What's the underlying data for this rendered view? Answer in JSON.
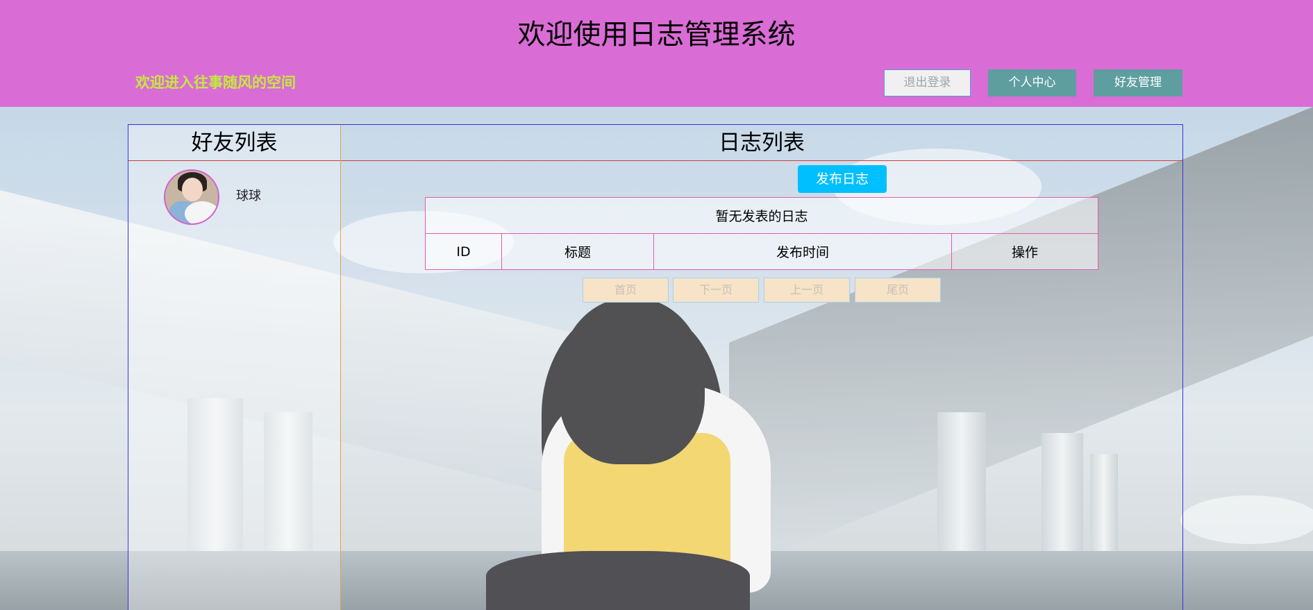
{
  "header": {
    "title": "欢迎使用日志管理系统",
    "welcome": "欢迎进入往事随风的空间",
    "logout_label": "退出登录",
    "profile_label": "个人中心",
    "friends_label": "好友管理"
  },
  "friends": {
    "title": "好友列表",
    "items": [
      {
        "name": "球球"
      }
    ]
  },
  "diary": {
    "title": "日志列表",
    "publish_label": "发布日志",
    "empty_message": "暂无发表的日志",
    "columns": [
      "ID",
      "标题",
      "发布时间",
      "操作"
    ]
  },
  "pagination": {
    "first_label": "首页",
    "next_label": "下一页",
    "prev_label": "上一页",
    "last_label": "尾页"
  },
  "colors": {
    "header_bg": "#da6cd6",
    "welcome_text": "#c4ea3c",
    "nav_button_bg": "#5f9ea0",
    "publish_button_bg": "#00bfff",
    "pager_bg": "#f6e3c8"
  }
}
